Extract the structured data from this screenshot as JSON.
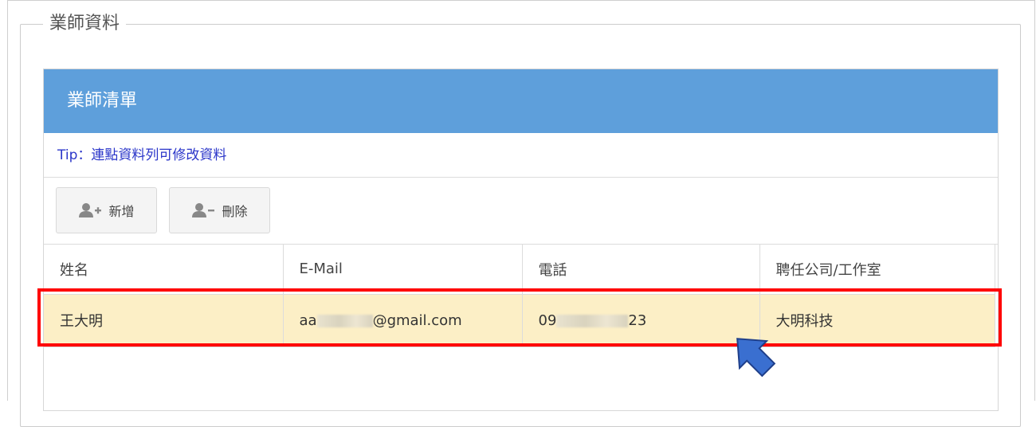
{
  "fieldset": {
    "legend": "業師資料"
  },
  "panel": {
    "title": "業師清單",
    "tip": "Tip：連點資料列可修改資料"
  },
  "toolbar": {
    "add_label": "新增",
    "delete_label": "刪除"
  },
  "table": {
    "headers": [
      "姓名",
      "E-Mail",
      "電話",
      "聘任公司/工作室"
    ],
    "rows": [
      {
        "name": "王大明",
        "email_start": "aa",
        "email_end": "@gmail.com",
        "phone_start": "09",
        "phone_end": "23",
        "company": "大明科技"
      }
    ]
  },
  "colors": {
    "header_bg": "#5e9fdb",
    "tip_text": "#2a35c9",
    "selected_row": "#fcefc6",
    "highlight": "#ff0000",
    "cursor": "#3a6fd0"
  },
  "icons": [
    "user-add-icon",
    "user-remove-icon",
    "pointer-arrow-icon"
  ]
}
